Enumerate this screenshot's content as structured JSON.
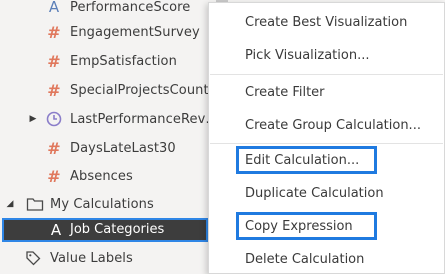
{
  "tree": {
    "items": [
      {
        "label": "PerformanceScore",
        "icon": "text-type-icon"
      },
      {
        "label": "EngagementSurvey",
        "icon": "number-type-icon"
      },
      {
        "label": "EmpSatisfaction",
        "icon": "number-type-icon"
      },
      {
        "label": "SpecialProjectsCount",
        "icon": "number-type-icon"
      },
      {
        "label": "LastPerformanceRev…",
        "icon": "date-type-icon"
      },
      {
        "label": "DaysLateLast30",
        "icon": "number-type-icon"
      },
      {
        "label": "Absences",
        "icon": "number-type-icon"
      }
    ],
    "folder_label": "My Calculations",
    "selected_label": "Job Categories",
    "value_labels": "Value Labels",
    "glyph_a": "A",
    "glyph_hash": "#"
  },
  "menu": {
    "items": [
      "Create Best Visualization",
      "Pick Visualization...",
      "Create Filter",
      "Create Group Calculation...",
      "Edit Calculation...",
      "Duplicate Calculation",
      "Copy Expression",
      "Delete Calculation"
    ]
  },
  "colors": {
    "highlight_border": "#1f7ae0",
    "selected_bg": "#3d3d3d",
    "text_type": "#5b7fb8",
    "number_type": "#e0785d"
  }
}
